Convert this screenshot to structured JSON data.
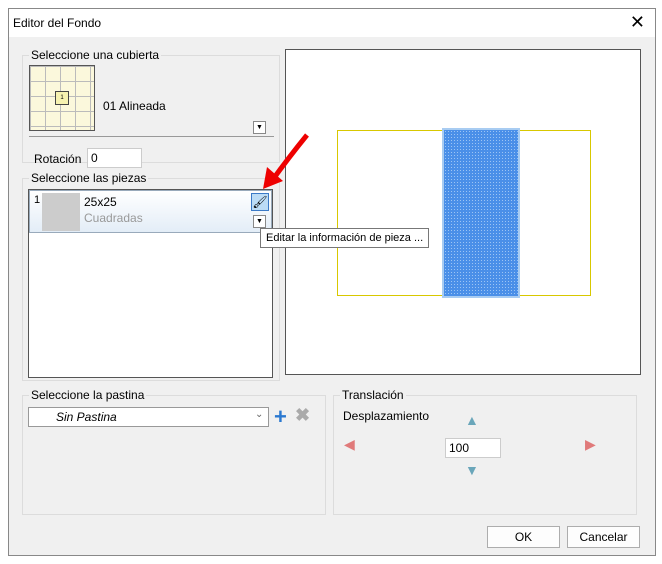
{
  "window": {
    "title": "Editor del Fondo"
  },
  "cubierta": {
    "label": "Seleccione una cubierta",
    "name": "01 Alineada",
    "rotation_label": "Rotación",
    "rotation_value": "0",
    "thumb_number": "1"
  },
  "piezas": {
    "label": "Seleccione las piezas",
    "items": [
      {
        "index": "1",
        "name": "25x25",
        "type": "Cuadradas"
      }
    ],
    "tooltip": "Editar la información de pieza ..."
  },
  "pastina": {
    "label": "Seleccione la pastina",
    "value": "Sin Pastina"
  },
  "translacion": {
    "label": "Translación",
    "sublabel": "Desplazamiento",
    "value": "100"
  },
  "buttons": {
    "ok": "OK",
    "cancel": "Cancelar"
  }
}
